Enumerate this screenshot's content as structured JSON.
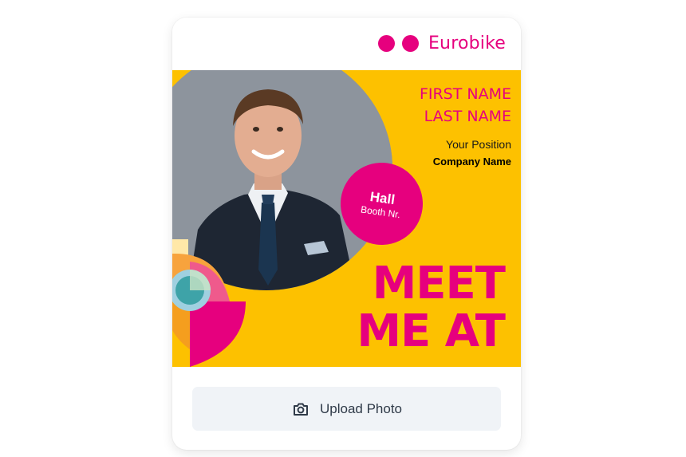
{
  "logo": {
    "text": "Eurobike"
  },
  "badge": {
    "first_name": "FIRST NAME",
    "last_name": "LAST NAME",
    "position": "Your Position",
    "company": "Company Name",
    "hall": "Hall",
    "booth": "Booth Nr.",
    "headline_line1": "MEET",
    "headline_line2": "ME AT"
  },
  "upload": {
    "label": "Upload Photo",
    "icon": "camera-icon"
  },
  "colors": {
    "brand_pink": "#e6007e",
    "banner_yellow": "#fdc100",
    "button_bg": "#f0f3f7"
  }
}
